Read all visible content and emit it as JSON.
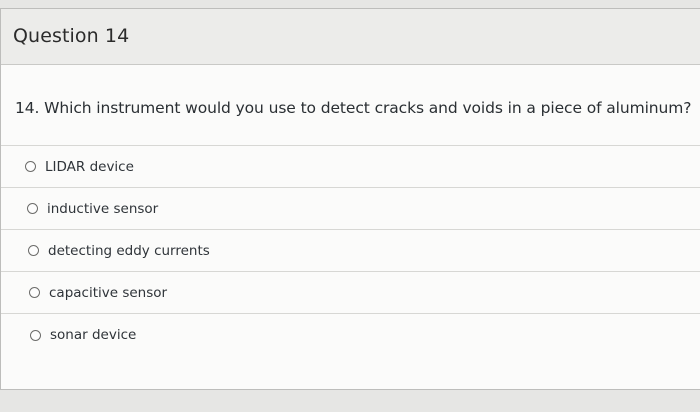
{
  "question": {
    "header_title": "Question 14",
    "text": "14. Which instrument would you use to detect cracks and voids in a piece of aluminum?"
  },
  "answers": [
    {
      "label": "LIDAR device",
      "selected": false
    },
    {
      "label": "inductive sensor",
      "selected": false
    },
    {
      "label": "detecting eddy currents",
      "selected": false
    },
    {
      "label": "capacitive sensor",
      "selected": false
    },
    {
      "label": "sonar device",
      "selected": false
    }
  ]
}
